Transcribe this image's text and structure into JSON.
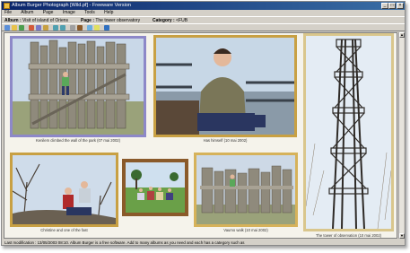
{
  "window": {
    "title": "Album Burger Photograph [Wild.pf] - Freeware Version",
    "controls": {
      "minimize": "_",
      "maximize": "□",
      "close": "×"
    }
  },
  "menubar": {
    "items": [
      "File",
      "Album",
      "Page",
      "Image",
      "Tools",
      "Help"
    ]
  },
  "infobar": {
    "album_label": "Album :",
    "album_value": "Visit of island of Oriens",
    "page_label": "Page :",
    "page_value": "The tower observatory",
    "category_label": "Category :",
    "category_value": "<FUB"
  },
  "photos": [
    {
      "caption": "Kenilem climbed the wall of the park (07 mai 2002)",
      "frame_color": "#8d88c8"
    },
    {
      "caption": "Has himself (10 mai 2002)",
      "frame_color": "#c8a043"
    },
    {
      "caption": "The tower of observation (10 mai 2002)",
      "frame_color": "#d9c68c"
    },
    {
      "caption": "Christine and one of the fast",
      "frame_color": "#c8a043"
    },
    {
      "caption": "",
      "frame_color": "#8a5a2a"
    },
    {
      "caption": "Vaumo walk (10 mai 2002)",
      "frame_color": "#d6b25a"
    }
  ],
  "statusbar": {
    "text": "Last modification : 13/05/2003 08:10. Album Burger is a free software. Add to many albums as you need and each has a category such as"
  },
  "colors": {
    "titlebar_start": "#0a246a",
    "titlebar_end": "#3a6ea5",
    "canvas": "#f5f3eb"
  }
}
